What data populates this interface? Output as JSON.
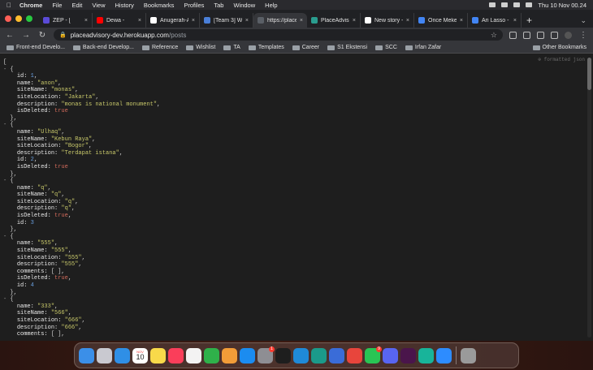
{
  "menubar": {
    "app": "Chrome",
    "items": [
      "File",
      "Edit",
      "View",
      "History",
      "Bookmarks",
      "Profiles",
      "Tab",
      "Window",
      "Help"
    ],
    "clock": "Thu 10 Nov  00.24"
  },
  "tabs": [
    {
      "label": "ZEP - [",
      "color": "#5b4bd8"
    },
    {
      "label": "Dewa - ",
      "color": "#ff0000"
    },
    {
      "label": "Anugerah-A",
      "color": "#ffffff"
    },
    {
      "label": "[Team 3] W",
      "color": "#4a7fd8"
    },
    {
      "label": "https://place",
      "color": "#5a5f66",
      "active": true
    },
    {
      "label": "PlaceAdviso",
      "color": "#2a9d8f"
    },
    {
      "label": "New story -",
      "color": "#ffffff"
    },
    {
      "label": "Once Mekel",
      "color": "#4285f4"
    },
    {
      "label": "Ari Lasso -",
      "color": "#4285f4"
    }
  ],
  "toolbar": {
    "url_host": "placeadvisory-dev.herokuapp.com",
    "url_path": "/posts"
  },
  "bookmarks": {
    "items": [
      "Front-end Develo...",
      "Back-end Develop...",
      "Reference",
      "Wishlist",
      "TA",
      "Templates",
      "Career",
      "S1 Ekstensi",
      "SCC",
      "Irfan Zafar"
    ],
    "other": "Other Bookmarks"
  },
  "json_lines": [
    {
      "indent": 0,
      "toggle": "",
      "parts": [
        [
          "p",
          "["
        ]
      ]
    },
    {
      "indent": 0,
      "toggle": "- ",
      "parts": [
        [
          "p",
          "{"
        ]
      ]
    },
    {
      "indent": 2,
      "toggle": "",
      "parts": [
        [
          "k",
          "id: "
        ],
        [
          "n",
          "1"
        ],
        [
          "p",
          ","
        ]
      ]
    },
    {
      "indent": 2,
      "toggle": "",
      "parts": [
        [
          "k",
          "name: "
        ],
        [
          "s",
          "\"anon\""
        ],
        [
          "p",
          ","
        ]
      ]
    },
    {
      "indent": 2,
      "toggle": "",
      "parts": [
        [
          "k",
          "siteName: "
        ],
        [
          "s",
          "\"monas\""
        ],
        [
          "p",
          ","
        ]
      ]
    },
    {
      "indent": 2,
      "toggle": "",
      "parts": [
        [
          "k",
          "siteLocation: "
        ],
        [
          "s",
          "\"Jakarta\""
        ],
        [
          "p",
          ","
        ]
      ]
    },
    {
      "indent": 2,
      "toggle": "",
      "parts": [
        [
          "k",
          "description: "
        ],
        [
          "s",
          "\"monas is national monument\""
        ],
        [
          "p",
          ","
        ]
      ]
    },
    {
      "indent": 2,
      "toggle": "",
      "parts": [
        [
          "k",
          "isDeleted: "
        ],
        [
          "b",
          "true"
        ]
      ]
    },
    {
      "indent": 1,
      "toggle": "",
      "parts": [
        [
          "p",
          "},"
        ]
      ]
    },
    {
      "indent": 0,
      "toggle": "- ",
      "parts": [
        [
          "p",
          "{"
        ]
      ]
    },
    {
      "indent": 2,
      "toggle": "",
      "parts": [
        [
          "k",
          "name: "
        ],
        [
          "s",
          "\"Ulhaq\""
        ],
        [
          "p",
          ","
        ]
      ]
    },
    {
      "indent": 2,
      "toggle": "",
      "parts": [
        [
          "k",
          "siteName: "
        ],
        [
          "s",
          "\"Kebun Raya\""
        ],
        [
          "p",
          ","
        ]
      ]
    },
    {
      "indent": 2,
      "toggle": "",
      "parts": [
        [
          "k",
          "siteLocation: "
        ],
        [
          "s",
          "\"Bogor\""
        ],
        [
          "p",
          ","
        ]
      ]
    },
    {
      "indent": 2,
      "toggle": "",
      "parts": [
        [
          "k",
          "description: "
        ],
        [
          "s",
          "\"Terdapat istana\""
        ],
        [
          "p",
          ","
        ]
      ]
    },
    {
      "indent": 2,
      "toggle": "",
      "parts": [
        [
          "k",
          "id: "
        ],
        [
          "n",
          "2"
        ],
        [
          "p",
          ","
        ]
      ]
    },
    {
      "indent": 2,
      "toggle": "",
      "parts": [
        [
          "k",
          "isDeleted: "
        ],
        [
          "b",
          "true"
        ]
      ]
    },
    {
      "indent": 1,
      "toggle": "",
      "parts": [
        [
          "p",
          "},"
        ]
      ]
    },
    {
      "indent": 0,
      "toggle": "- ",
      "parts": [
        [
          "p",
          "{"
        ]
      ]
    },
    {
      "indent": 2,
      "toggle": "",
      "parts": [
        [
          "k",
          "name: "
        ],
        [
          "s",
          "\"q\""
        ],
        [
          "p",
          ","
        ]
      ]
    },
    {
      "indent": 2,
      "toggle": "",
      "parts": [
        [
          "k",
          "siteName: "
        ],
        [
          "s",
          "\"q\""
        ],
        [
          "p",
          ","
        ]
      ]
    },
    {
      "indent": 2,
      "toggle": "",
      "parts": [
        [
          "k",
          "siteLocation: "
        ],
        [
          "s",
          "\"q\""
        ],
        [
          "p",
          ","
        ]
      ]
    },
    {
      "indent": 2,
      "toggle": "",
      "parts": [
        [
          "k",
          "description: "
        ],
        [
          "s",
          "\"q\""
        ],
        [
          "p",
          ","
        ]
      ]
    },
    {
      "indent": 2,
      "toggle": "",
      "parts": [
        [
          "k",
          "isDeleted: "
        ],
        [
          "b",
          "true"
        ],
        [
          "p",
          ","
        ]
      ]
    },
    {
      "indent": 2,
      "toggle": "",
      "parts": [
        [
          "k",
          "id: "
        ],
        [
          "n",
          "3"
        ]
      ]
    },
    {
      "indent": 1,
      "toggle": "",
      "parts": [
        [
          "p",
          "},"
        ]
      ]
    },
    {
      "indent": 0,
      "toggle": "- ",
      "parts": [
        [
          "p",
          "{"
        ]
      ]
    },
    {
      "indent": 2,
      "toggle": "",
      "parts": [
        [
          "k",
          "name: "
        ],
        [
          "s",
          "\"555\""
        ],
        [
          "p",
          ","
        ]
      ]
    },
    {
      "indent": 2,
      "toggle": "",
      "parts": [
        [
          "k",
          "siteName: "
        ],
        [
          "s",
          "\"555\""
        ],
        [
          "p",
          ","
        ]
      ]
    },
    {
      "indent": 2,
      "toggle": "",
      "parts": [
        [
          "k",
          "siteLocation: "
        ],
        [
          "s",
          "\"555\""
        ],
        [
          "p",
          ","
        ]
      ]
    },
    {
      "indent": 2,
      "toggle": "",
      "parts": [
        [
          "k",
          "description: "
        ],
        [
          "s",
          "\"555\""
        ],
        [
          "p",
          ","
        ]
      ]
    },
    {
      "indent": 2,
      "toggle": "",
      "parts": [
        [
          "k",
          "comments: "
        ],
        [
          "p",
          "[ ],"
        ]
      ]
    },
    {
      "indent": 2,
      "toggle": "",
      "parts": [
        [
          "k",
          "isDeleted: "
        ],
        [
          "b",
          "true"
        ],
        [
          "p",
          ","
        ]
      ]
    },
    {
      "indent": 2,
      "toggle": "",
      "parts": [
        [
          "k",
          "id: "
        ],
        [
          "n",
          "4"
        ]
      ]
    },
    {
      "indent": 1,
      "toggle": "",
      "parts": [
        [
          "p",
          "},"
        ]
      ]
    },
    {
      "indent": 0,
      "toggle": "- ",
      "parts": [
        [
          "p",
          "{"
        ]
      ]
    },
    {
      "indent": 2,
      "toggle": "",
      "parts": [
        [
          "k",
          "name: "
        ],
        [
          "s",
          "\"333\""
        ],
        [
          "p",
          ","
        ]
      ]
    },
    {
      "indent": 2,
      "toggle": "",
      "parts": [
        [
          "k",
          "siteName: "
        ],
        [
          "s",
          "\"566\""
        ],
        [
          "p",
          ","
        ]
      ]
    },
    {
      "indent": 2,
      "toggle": "",
      "parts": [
        [
          "k",
          "siteLocation: "
        ],
        [
          "s",
          "\"666\""
        ],
        [
          "p",
          ","
        ]
      ]
    },
    {
      "indent": 2,
      "toggle": "",
      "parts": [
        [
          "k",
          "description: "
        ],
        [
          "s",
          "\"666\""
        ],
        [
          "p",
          ","
        ]
      ]
    },
    {
      "indent": 2,
      "toggle": "",
      "parts": [
        [
          "k",
          "comments: "
        ],
        [
          "p",
          "[ ],"
        ]
      ]
    }
  ],
  "dock": {
    "calendar_month": "NOV",
    "calendar_day": "10",
    "apps": [
      {
        "name": "finder-icon",
        "color": "#3b8fe8"
      },
      {
        "name": "launchpad-icon",
        "color": "#c9c9d0"
      },
      {
        "name": "safari-icon",
        "color": "#2f8fe6"
      },
      {
        "name": "calendar-icon",
        "color": "#ffffff",
        "calendar": true
      },
      {
        "name": "notes-icon",
        "color": "#f8d94a"
      },
      {
        "name": "music-icon",
        "color": "#fa3e5a"
      },
      {
        "name": "photos-icon",
        "color": "#f3f3f3"
      },
      {
        "name": "numbers-icon",
        "color": "#2fb14a"
      },
      {
        "name": "pages-icon",
        "color": "#f29c38"
      },
      {
        "name": "app-store-icon",
        "color": "#1b8cf0"
      },
      {
        "name": "system-settings-icon",
        "color": "#8e8e93",
        "badge": "1"
      },
      {
        "name": "figma-icon",
        "color": "#1e1e1e"
      },
      {
        "name": "vscode-icon",
        "color": "#1f8ad8"
      },
      {
        "name": "vscode-insiders-icon",
        "color": "#1b9a8a"
      },
      {
        "name": "proxyman-icon",
        "color": "#3a6cd8"
      },
      {
        "name": "chrome-icon",
        "color": "#e8453c"
      },
      {
        "name": "whatsapp-icon",
        "color": "#29c554",
        "badge": "9"
      },
      {
        "name": "discord-icon",
        "color": "#5865f2"
      },
      {
        "name": "slack-icon",
        "color": "#4a154b"
      },
      {
        "name": "teal-app-icon",
        "color": "#18b49a"
      },
      {
        "name": "zoom-icon",
        "color": "#2d8cff"
      },
      {
        "name": "trash-icon",
        "color": "#9a9a9a",
        "separated": true
      }
    ]
  },
  "content": {
    "extension_badge": "⊕ formatted json"
  }
}
